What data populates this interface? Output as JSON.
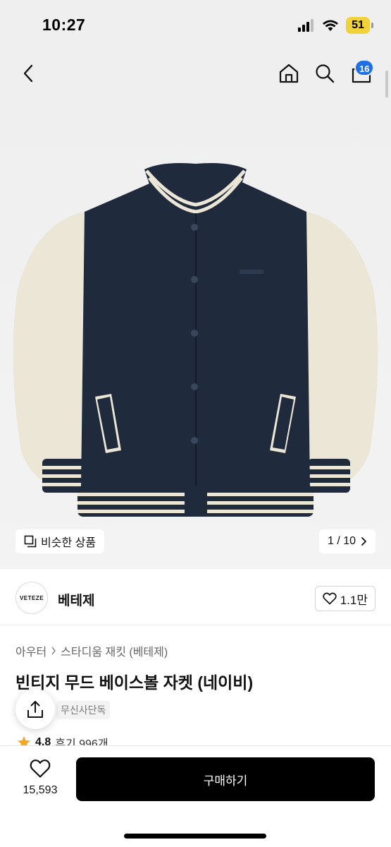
{
  "status": {
    "time": "10:27",
    "battery": "51"
  },
  "nav": {
    "back_icon": "chevron-left-icon",
    "home_icon": "home-icon",
    "search_icon": "search-icon",
    "cart_icon": "shopping-bag-icon",
    "cart_badge": "16"
  },
  "gallery": {
    "similar_label": "비슷한 상품",
    "pager": "1 / 10"
  },
  "brand": {
    "logo_text": "VETEZE",
    "name": "베테제",
    "like_count": "1.1만"
  },
  "product": {
    "breadcrumb": [
      "아우터",
      "스타디움 재킷 (베테제)"
    ],
    "title": "빈티지 무드 베이스볼 자켓 (네이비)",
    "exclusive_tag": "무신사단독",
    "rating": "4.8",
    "reviews": "후기 996개"
  },
  "bottom": {
    "wish_count": "15,593",
    "buy_label": "구매하기"
  },
  "colors": {
    "navy": "#1f2a3d",
    "cream": "#ece6d6",
    "badge": "#1f6fe5",
    "battery": "#f2d23a"
  }
}
